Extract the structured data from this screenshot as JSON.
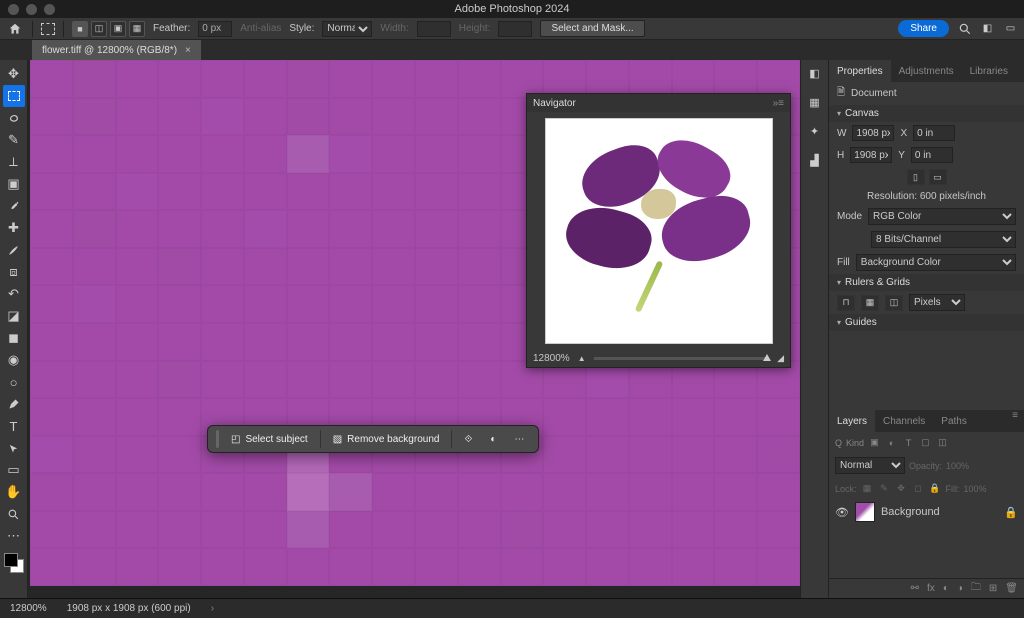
{
  "app": {
    "title": "Adobe Photoshop 2024"
  },
  "options": {
    "feather_label": "Feather:",
    "feather_value": "0 px",
    "anti_alias": "Anti-alias",
    "style_label": "Style:",
    "style_value": "Normal",
    "width_label": "Width:",
    "height_label": "Height:",
    "select_mask": "Select and Mask...",
    "share": "Share"
  },
  "document": {
    "tab_label": "flower.tiff @ 12800% (RGB/8*)"
  },
  "tools": [
    "move",
    "marquee",
    "lasso",
    "quick-select",
    "crop",
    "frame",
    "eyedropper",
    "healing",
    "brush",
    "clone",
    "history-brush",
    "eraser",
    "gradient",
    "blur",
    "dodge",
    "pen",
    "type",
    "path-select",
    "rectangle",
    "hand",
    "zoom",
    "edit-toolbar"
  ],
  "context_bar": {
    "select_subject": "Select subject",
    "remove_bg": "Remove background"
  },
  "navigator": {
    "title": "Navigator",
    "zoom": "12800%"
  },
  "properties": {
    "tab_properties": "Properties",
    "tab_adjustments": "Adjustments",
    "tab_libraries": "Libraries",
    "doc_label": "Document",
    "canvas_section": "Canvas",
    "w_label": "W",
    "w_value": "1908 px",
    "x_label": "X",
    "x_value": "0 in",
    "h_label": "H",
    "h_value": "1908 px",
    "y_label": "Y",
    "y_value": "0 in",
    "resolution": "Resolution: 600 pixels/inch",
    "mode_label": "Mode",
    "mode_value": "RGB Color",
    "bits_value": "8 Bits/Channel",
    "fill_label": "Fill",
    "fill_value": "Background Color",
    "rulers_section": "Rulers & Grids",
    "units_value": "Pixels",
    "guides_section": "Guides"
  },
  "layers": {
    "tab_layers": "Layers",
    "tab_channels": "Channels",
    "tab_paths": "Paths",
    "kind_label": "Kind",
    "blend_mode": "Normal",
    "opacity_label": "Opacity:",
    "opacity_value": "100%",
    "lock_label": "Lock:",
    "fill_label": "Fill:",
    "fill_value": "100%",
    "layer_name": "Background"
  },
  "status": {
    "zoom": "12800%",
    "info": "1908 px x 1908 px (600 ppi)"
  },
  "canvas_pixels": [
    "a34aa8",
    "a14aa6",
    "a34aa8",
    "a34aa8",
    "a34aa8",
    "a34aa8",
    "a14aa6",
    "a34aa8",
    "a34aa8",
    "a34aa8",
    "a34aa8",
    "a34aa8",
    "a34aa8",
    "a34aa8",
    "a34aa8",
    "a34aa8",
    "a34aa8",
    "a34aa8",
    "a34aa8",
    "a14aa6",
    "a34aa8",
    "a34aa8",
    "a44cac",
    "a34aa8",
    "a14aa6",
    "a34aa8",
    "a34aa8",
    "a34aa8",
    "a34aa8",
    "a34aa8",
    "a34aa8",
    "a34aa8",
    "a34aa8",
    "a34aa8",
    "a34aa8",
    "a14aa6",
    "a34aa8",
    "a34aa8",
    "a34aa8",
    "a34aa8",
    "a34aa8",
    "a34aa8",
    "a85cb0",
    "a44cac",
    "a34aa8",
    "a34aa8",
    "a34aa8",
    "a34aa8",
    "a34aa8",
    "a34aa8",
    "a34aa8",
    "a34aa8",
    "a34aa8",
    "a34aa8",
    "a34aa8",
    "a34aa8",
    "a44cac",
    "a34aa8",
    "a34aa8",
    "a34aa8",
    "a34aa8",
    "a34aa8",
    "a34aa8",
    "a34aa8",
    "a34aa8",
    "a34aa8",
    "a14aa6",
    "a34aa8",
    "a34aa8",
    "a34aa8",
    "a34aa8",
    "a34aa8",
    "a34aa8",
    "a14aa6",
    "a34aa8",
    "a34aa8",
    "a34aa8",
    "a44cac",
    "a34aa8",
    "a34aa8",
    "a34aa8",
    "a34aa8",
    "a34aa8",
    "a34aa8",
    "a34aa8",
    "a34aa8",
    "a34aa8",
    "a34aa8",
    "a34aa8",
    "a14aa6",
    "a34aa8",
    "a34aa8",
    "a34aa8",
    "a14aa6",
    "a34aa8",
    "a34aa8",
    "a34aa8",
    "a34aa8",
    "a34aa8",
    "a34aa8",
    "a34aa8",
    "a14aa6",
    "a34aa8",
    "a34aa8",
    "a34aa8",
    "a34aa8",
    "a34aa8",
    "a34aa8",
    "a34aa8",
    "a44cac",
    "a34aa8",
    "a34aa8",
    "a34aa8",
    "a34aa8",
    "a34aa8",
    "a34aa8",
    "a34aa8",
    "a34aa8",
    "a34aa8",
    "a34aa8",
    "a34aa8",
    "a34aa8",
    "a34aa8",
    "a14aa6",
    "a34aa8",
    "a34aa8",
    "a34aa8",
    "a34aa8",
    "a34aa8",
    "a34aa8",
    "a34aa8",
    "a34aa8",
    "a34aa8",
    "a34aa8",
    "a34aa8",
    "a34aa8",
    "a34aa8",
    "a34aa8",
    "a34aa8",
    "a34aa8",
    "a34aa8",
    "a34aa8",
    "a34aa8",
    "a34aa8",
    "a34aa8",
    "a34aa8",
    "a34aa8",
    "a14aa6",
    "a34aa8",
    "a34aa8",
    "a34aa8",
    "a34aa8",
    "a34aa8",
    "a34aa8",
    "a34aa8",
    "a34aa8",
    "a34aa8",
    "a44cac",
    "a34aa8",
    "a34aa8",
    "a34aa8",
    "a34aa8",
    "a34aa8",
    "a34aa8",
    "a34aa8",
    "a34aa8",
    "a34aa8",
    "a34aa8",
    "a34aa8",
    "a34aa8",
    "a34aa8",
    "a34aa8",
    "a34aa8",
    "a34aa8",
    "a34aa8",
    "a34aa8",
    "a34aa8",
    "a34aa8",
    "a34aa8",
    "a34aa8",
    "a44cac",
    "a34aa8",
    "a34aa8",
    "a34aa8",
    "a34aa8",
    "a34aa8",
    "b367b8",
    "a34aa8",
    "a34aa8",
    "a34aa8",
    "a34aa8",
    "a34aa8",
    "a34aa8",
    "a34aa8",
    "a34aa8",
    "a34aa8",
    "a34aa8",
    "a14aa6",
    "a34aa8",
    "a34aa8",
    "a34aa8",
    "a34aa8",
    "a34aa8",
    "a34aa8",
    "b66eba",
    "a85cb0",
    "a34aa8",
    "a34aa8",
    "a34aa8",
    "a34aa8",
    "a34aa8",
    "a34aa8",
    "a34aa8",
    "a34aa8",
    "a34aa8",
    "a34aa8",
    "a34aa8",
    "a34aa8",
    "a34aa8",
    "a34aa8",
    "a34aa8",
    "a34aa8",
    "a85cb0",
    "a34aa8",
    "a34aa8",
    "a34aa8",
    "a34aa8",
    "a14aa6",
    "a34aa8",
    "a34aa8",
    "a34aa8",
    "a34aa8",
    "a34aa8",
    "a34aa8",
    "a34aa8",
    "a34aa8",
    "a34aa8",
    "a34aa8",
    "a34aa8",
    "a34aa8",
    "a34aa8",
    "a34aa8",
    "a34aa8",
    "a34aa8",
    "a34aa8",
    "a34aa8",
    "a34aa8",
    "a34aa8",
    "a34aa8",
    "a34aa8",
    "a34aa8",
    "a34aa8"
  ]
}
